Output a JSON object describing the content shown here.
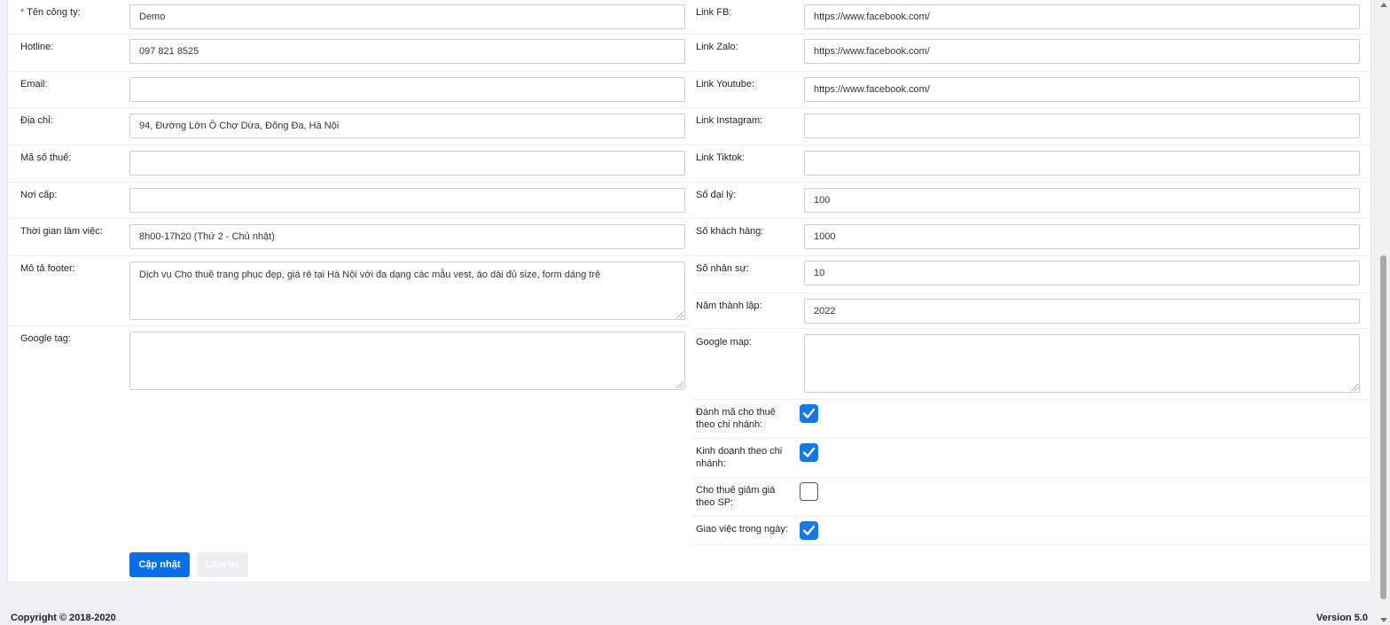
{
  "left": {
    "company": {
      "required_mark": "*",
      "label": " Tên công ty:",
      "value": "Demo"
    },
    "hotline": {
      "label": "Hotline:",
      "value": "097 821 8525"
    },
    "email": {
      "label": "Email:",
      "value": ""
    },
    "address": {
      "label": "Địa chỉ:",
      "value": "94, Đường Lớn Ô Chợ Dừa, Đống Đa, Hà Nội"
    },
    "tax_code": {
      "label": "Mã số thuế:",
      "value": ""
    },
    "issued_at": {
      "label": "Nơi cấp:",
      "value": ""
    },
    "working_hours": {
      "label": "Thời gian làm việc:",
      "value": "8h00-17h20 (Thứ 2 - Chủ nhật)"
    },
    "footer_desc": {
      "label": "Mô tả footer:",
      "value": "Dịch vụ Cho thuê trang phục đẹp, giá rẻ tại Hà Nội với đa dạng các mẫu vest, áo dài đủ size, form dáng trẻ"
    },
    "google_tag": {
      "label": "Google tag:",
      "value": ""
    }
  },
  "right": {
    "link_fb": {
      "label": "Link FB:",
      "value": "https://www.facebook.com/"
    },
    "link_zalo": {
      "label": "Link Zalo:",
      "value": "https://www.facebook.com/"
    },
    "link_youtube": {
      "label": "Link Youtube:",
      "value": "https://www.facebook.com/"
    },
    "link_instagram": {
      "label": "Link Instagram:",
      "value": ""
    },
    "link_tiktok": {
      "label": "Link Tiktok:",
      "value": ""
    },
    "agents": {
      "label": "Số đại lý:",
      "value": "100"
    },
    "customers": {
      "label": "Số khách hàng:",
      "value": "1000"
    },
    "staff": {
      "label": "Số nhân sự:",
      "value": "10"
    },
    "founded": {
      "label": "Năm thành lập:",
      "value": "2022"
    },
    "google_map": {
      "label": "Google map:",
      "value": ""
    },
    "branch_code": {
      "label": "Đánh mã cho thuê theo chi nhánh:",
      "checked": true
    },
    "branch_business": {
      "label": "Kinh doanh theo chi nhánh:",
      "checked": true
    },
    "rent_discount": {
      "label": "Cho thuê giảm giá theo SP:",
      "checked": false
    },
    "daily_tasks": {
      "label": "Giao việc trong ngày:",
      "checked": true
    }
  },
  "actions": {
    "save_label": "Cập nhật",
    "reset_label": "Làm lại"
  },
  "footer": {
    "copyright": "Copyright © 2018-2020",
    "version": "Version 5.0"
  },
  "colors": {
    "primary": "#0a6ee8",
    "checkbox": "#1677e6",
    "required": "#e03131"
  }
}
